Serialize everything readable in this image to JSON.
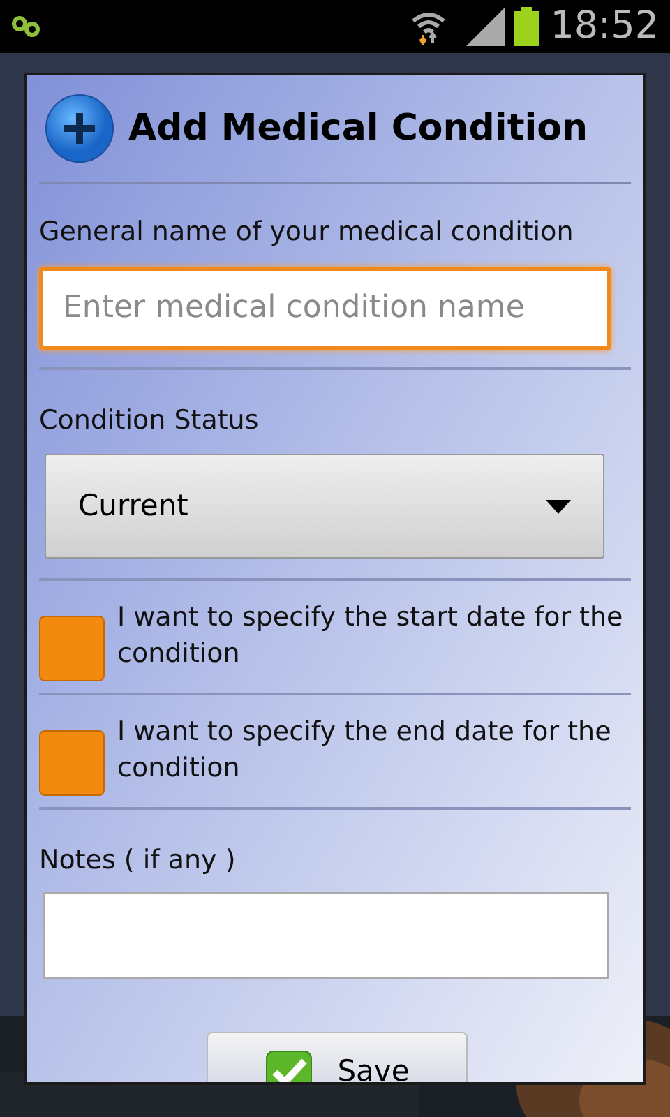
{
  "status_bar": {
    "time": "18:52"
  },
  "dialog": {
    "title": "Add Medical Condition",
    "name_field": {
      "label": "General name of your medical condition",
      "placeholder": "Enter medical condition name",
      "focused": true
    },
    "status": {
      "label": "Condition Status",
      "value": "Current"
    },
    "options": [
      {
        "label": "I want to specify the start date for the condition",
        "checked": false
      },
      {
        "label": "I want to specify the end date for the condition",
        "checked": false
      }
    ],
    "notes": {
      "label": "Notes ( if any )"
    },
    "save_button": {
      "label": "Save"
    }
  }
}
